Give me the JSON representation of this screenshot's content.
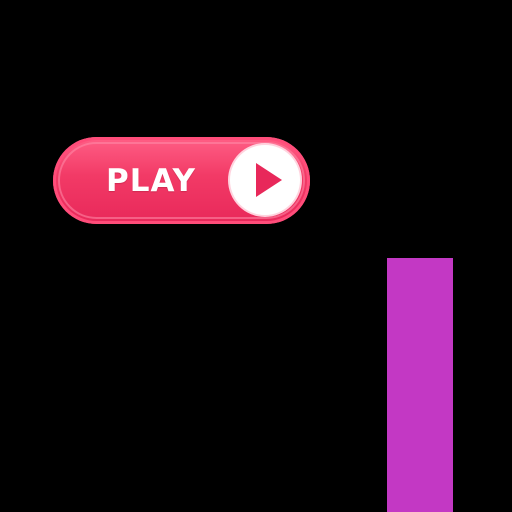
{
  "play_button": {
    "label": "PLAY",
    "icon": "play-triangle-icon",
    "color": "#f23a66"
  },
  "bar": {
    "color": "#c338c4"
  },
  "background_color": "#000000"
}
